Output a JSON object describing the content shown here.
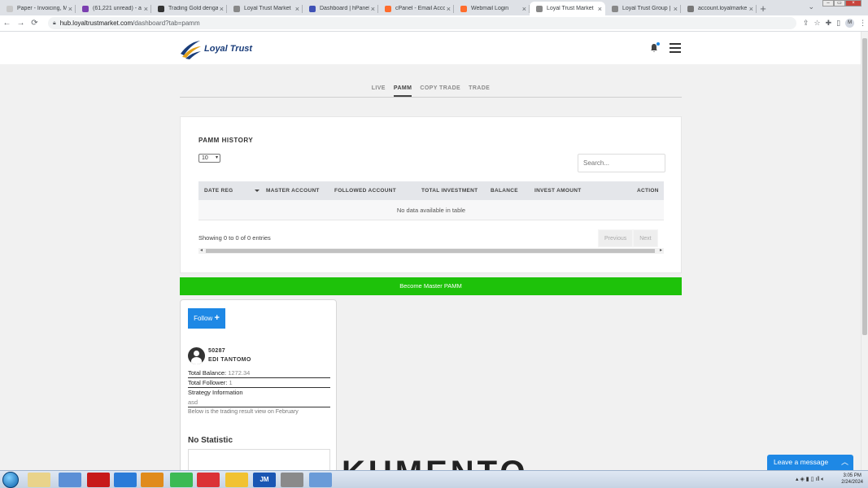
{
  "browser": {
    "tabs": [
      {
        "title": "Paper - Invoicing, M",
        "fav": "#c8c8c8"
      },
      {
        "title": "(61,221 unread) - a",
        "fav": "#7b3fb0"
      },
      {
        "title": "Trading Gold dengan",
        "fav": "#333333"
      },
      {
        "title": "Loyal Trust Market",
        "fav": "#888888"
      },
      {
        "title": "Dashboard | hPanel",
        "fav": "#3f51b5"
      },
      {
        "title": "cPanel - Email Accou",
        "fav": "#ff6c2c"
      },
      {
        "title": "Webmail Login",
        "fav": "#ff6c2c"
      },
      {
        "title": "Loyal Trust Market",
        "fav": "#888888",
        "active": true
      },
      {
        "title": "Loyal Trust Group |",
        "fav": "#888888"
      },
      {
        "title": "account.loyalmarke",
        "fav": "#777777"
      }
    ],
    "url_host": "hub.loyaltrustmarket.com",
    "url_path": "/dashboard?tab=pamm",
    "profile_initial": "M"
  },
  "site": {
    "brand": "Loyal Trust"
  },
  "tabs": [
    {
      "label": "LIVE",
      "active": false
    },
    {
      "label": "PAMM",
      "active": true
    },
    {
      "label": "COPY TRADE",
      "active": false
    },
    {
      "label": "TRADE",
      "active": false
    }
  ],
  "history": {
    "title": "PAMM HISTORY",
    "page_length": "10",
    "search_placeholder": "Search...",
    "columns": [
      "DATE REG",
      "MASTER ACCOUNT",
      "FOLLOWED ACCOUNT",
      "TOTAL INVESTMENT",
      "BALANCE",
      "INVEST AMOUNT",
      "ACTION"
    ],
    "empty_text": "No data available in table",
    "info": "Showing 0 to 0 of 0 entries",
    "prev": "Previous",
    "next": "Next"
  },
  "become_master": "Become Master PAMM",
  "master": {
    "follow_label": "Follow",
    "follow_plus": "+",
    "id": "50287",
    "name": "EDI TANTOMO",
    "total_balance_label": "Total Balance:",
    "total_balance": "1272.34",
    "total_follower_label": "Total Follower:",
    "total_follower": "1",
    "strategy_label": "Strategy Information",
    "strategy": "asd",
    "note": "Below is the trading result view on February",
    "no_stat": "No Statistic"
  },
  "background_text": "KUMENTO",
  "chat": {
    "label": "Leave a message",
    "icon": "chevron-up-icon"
  },
  "taskbar": {
    "time": "3:05 PM",
    "date": "2/24/2024",
    "jm_label": "JM"
  },
  "colors": {
    "accent": "#1e88e5",
    "success": "#1ec20a",
    "brand": "#1a3d7a"
  }
}
